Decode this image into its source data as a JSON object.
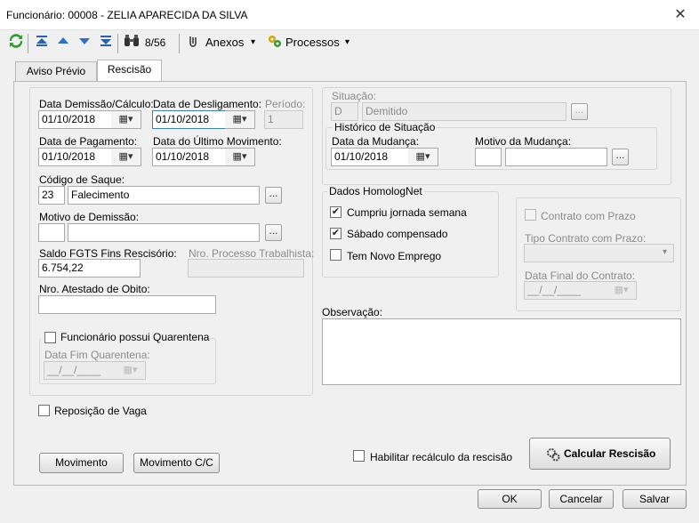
{
  "window": {
    "title": "Funcionário: 00008 - ZELIA APARECIDA DA SILVA",
    "close_glyph": "✕"
  },
  "toolbar": {
    "record_counter": "8/56",
    "anexos_label": "Anexos",
    "processos_label": "Processos"
  },
  "tabs": [
    {
      "label": "Aviso Prévio"
    },
    {
      "label": "Rescisão"
    }
  ],
  "left": {
    "data_demissao": {
      "label": "Data Demissão/Cálculo:",
      "value": "01/10/2018"
    },
    "data_desligamento": {
      "label": "Data de Desligamento:",
      "value": "01/10/2018"
    },
    "periodo": {
      "label": "Período:",
      "value": "1"
    },
    "data_pagamento": {
      "label": "Data de Pagamento:",
      "value": "01/10/2018"
    },
    "data_ultimo_mov": {
      "label": "Data do Último Movimento:",
      "value": "01/10/2018"
    },
    "codigo_saque": {
      "label": "Código de Saque:",
      "code": "23",
      "description": "Falecimento"
    },
    "motivo_demissao": {
      "label": "Motivo de Demissão:",
      "code": "",
      "description": ""
    },
    "saldo_fgts": {
      "label": "Saldo FGTS Fins Rescisório:",
      "value": "6.754,22"
    },
    "nro_processo": {
      "label": "Nro. Processo Trabalhista:",
      "value": ""
    },
    "nro_atestado": {
      "label": "Nro. Atestado de Obito:",
      "value": ""
    },
    "quarentena": {
      "label": "Funcionário possui Quarentena",
      "checked": false,
      "data_fim_label": "Data Fim Quarentena:",
      "data_fim_value": "__/__/____"
    }
  },
  "situacao": {
    "label": "Situação:",
    "code": "D",
    "description": "Demitido",
    "historico": {
      "title": "Histórico de Situação",
      "data_label": "Data da Mudança:",
      "data_value": "01/10/2018",
      "motivo_label": "Motivo da Mudança:",
      "motivo_code": "",
      "motivo_desc": ""
    }
  },
  "homolognet": {
    "title": "Dados HomologNet",
    "cumpriu": {
      "label": "Cumpriu jornada semana",
      "checked": true
    },
    "sabado": {
      "label": "Sábado compensado",
      "checked": true
    },
    "novo_emprego": {
      "label": "Tem Novo Emprego",
      "checked": false
    }
  },
  "contrato": {
    "label": "Contrato com Prazo",
    "checked": false,
    "tipo_label": "Tipo Contrato com Prazo:",
    "tipo_value": "",
    "data_final_label": "Data Final do Contrato:",
    "data_final_value": "__/__/____"
  },
  "observacao": {
    "label": "Observação:",
    "value": ""
  },
  "reposicao": {
    "label": "Reposição de Vaga",
    "checked": false
  },
  "habilitar": {
    "label": "Habilitar recálculo da rescisão",
    "checked": false
  },
  "buttons": {
    "movimento": "Movimento",
    "movimento_cc": "Movimento C/C",
    "calcular": "Calcular Rescisão",
    "ok": "OK",
    "cancelar": "Cancelar",
    "salvar": "Salvar"
  },
  "glyphs": {
    "ellipsis": "...",
    "check": "✔",
    "dropdown": "▾",
    "calendar": "▦"
  }
}
